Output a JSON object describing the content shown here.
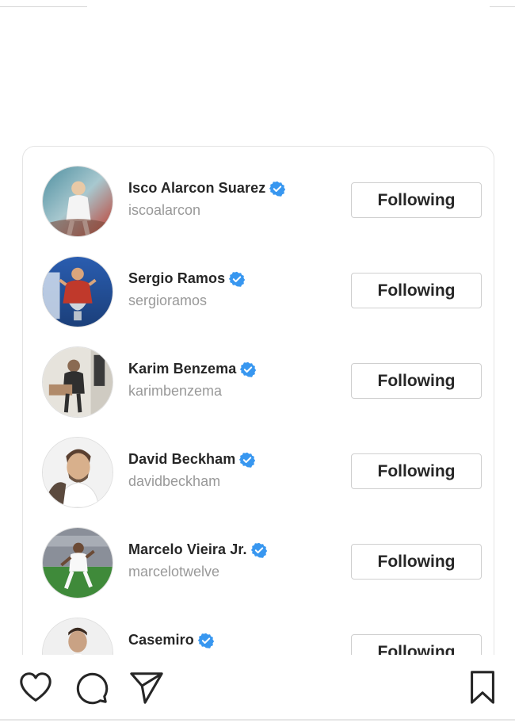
{
  "accounts": [
    {
      "name": "Isco Alarcon Suarez",
      "handle": "iscoalarcon",
      "button_label": "Following",
      "verified": true
    },
    {
      "name": "Sergio Ramos",
      "handle": "sergioramos",
      "button_label": "Following",
      "verified": true
    },
    {
      "name": "Karim Benzema",
      "handle": "karimbenzema",
      "button_label": "Following",
      "verified": true
    },
    {
      "name": "David Beckham",
      "handle": "davidbeckham",
      "button_label": "Following",
      "verified": true
    },
    {
      "name": "Marcelo Vieira Jr.",
      "handle": "marcelotwelve",
      "button_label": "Following",
      "verified": true
    },
    {
      "name": "Casemiro",
      "handle": "",
      "button_label": "Following",
      "verified": true
    }
  ],
  "bottom_bar": {
    "icons": [
      "heart-icon",
      "comment-icon",
      "share-icon",
      "bookmark-icon"
    ]
  },
  "colors": {
    "verified_blue": "#3897f0",
    "text": "#262626",
    "secondary_text": "#999999",
    "button_border": "#cfcfcf"
  }
}
